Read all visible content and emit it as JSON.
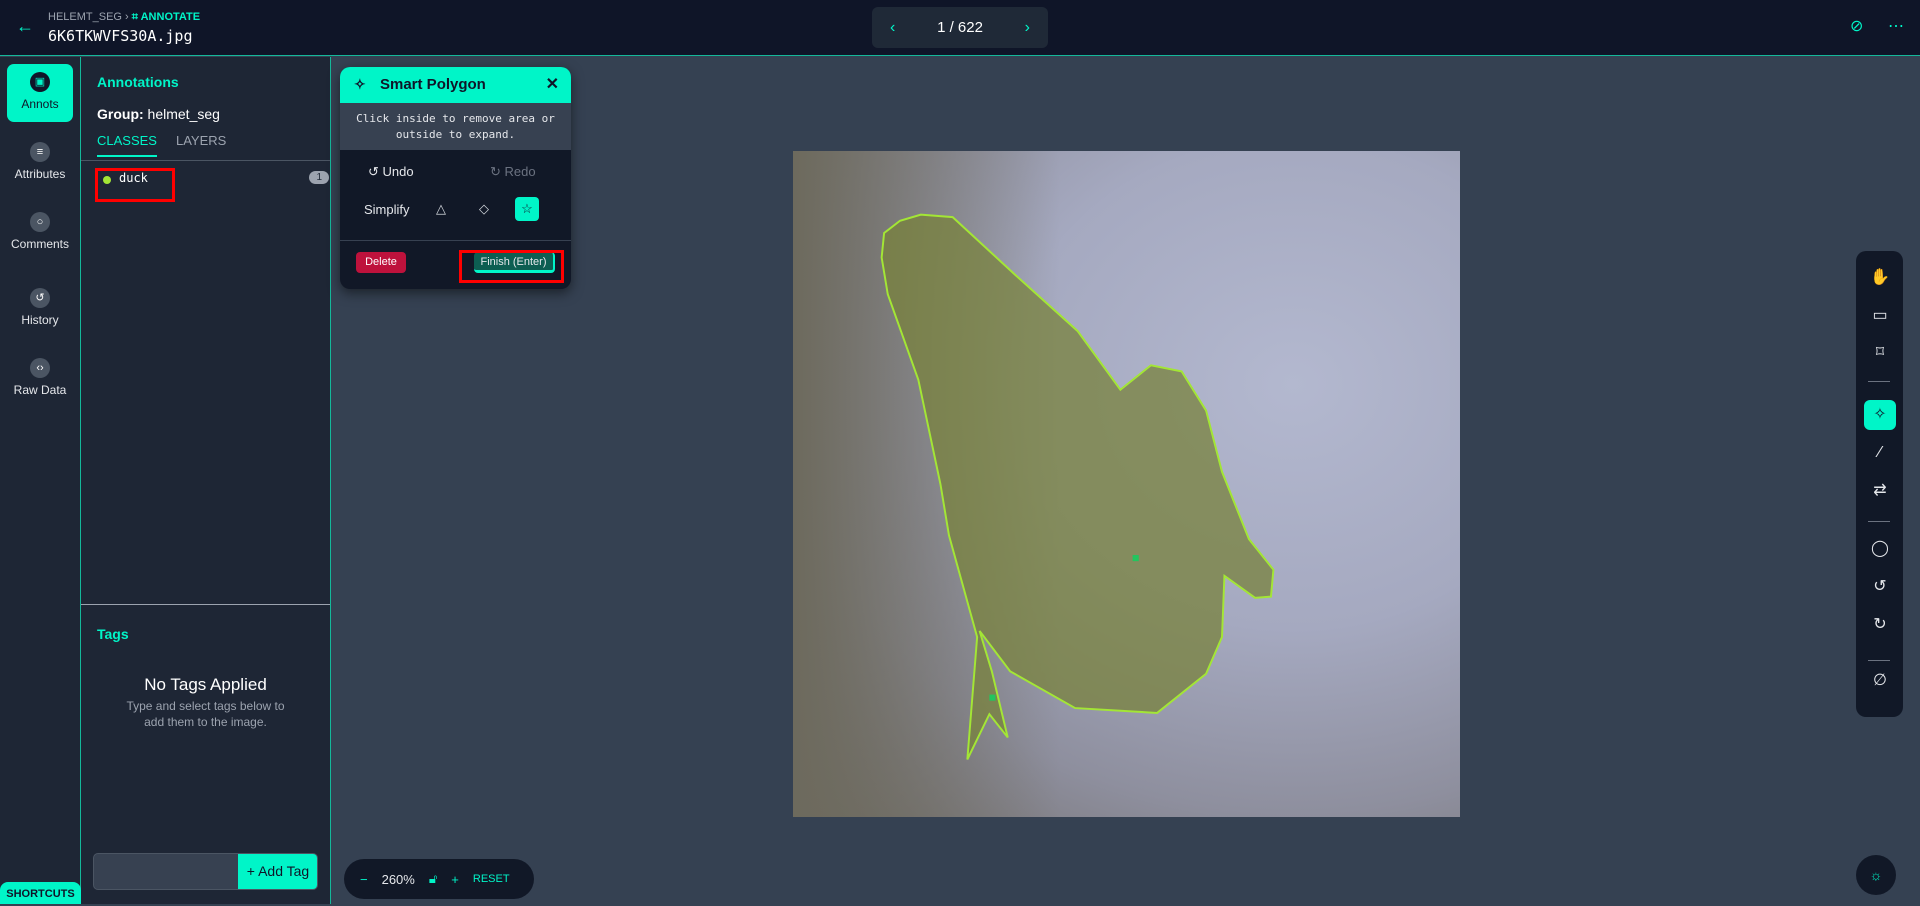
{
  "header": {
    "project": "HELEMT_SEG",
    "mode": "ANNOTATE",
    "filename": "6K6TKWVFS30A.jpg",
    "pager": "1 / 622"
  },
  "rail": {
    "items": [
      {
        "label": "Annots",
        "icon": "annotation-icon"
      },
      {
        "label": "Attributes",
        "icon": "list-icon"
      },
      {
        "label": "Comments",
        "icon": "comment-icon"
      },
      {
        "label": "History",
        "icon": "history-icon"
      },
      {
        "label": "Raw Data",
        "icon": "code-icon"
      }
    ],
    "shortcuts": "SHORTCUTS"
  },
  "panel": {
    "title": "Annotations",
    "group_label": "Group:",
    "group": "helmet_seg",
    "tabs": [
      "CLASSES",
      "LAYERS"
    ],
    "classes": [
      {
        "name": "duck",
        "count": "1",
        "color": "#a3e635"
      }
    ],
    "tags_title": "Tags",
    "no_tags": "No Tags Applied",
    "no_tags_hint": "Type and select tags below to add them to the image.",
    "add_tag": "Add Tag"
  },
  "smart_polygon": {
    "title": "Smart Polygon",
    "hint": "Click inside to remove area or outside to expand.",
    "undo": "Undo",
    "redo": "Redo",
    "simplify": "Simplify",
    "delete": "Delete",
    "finish": "Finish (Enter)"
  },
  "zoom": {
    "level": "260%",
    "reset": "RESET"
  },
  "colors": {
    "accent": "#00f5c8",
    "polygon": "#a3e635",
    "delete": "#be123c"
  }
}
